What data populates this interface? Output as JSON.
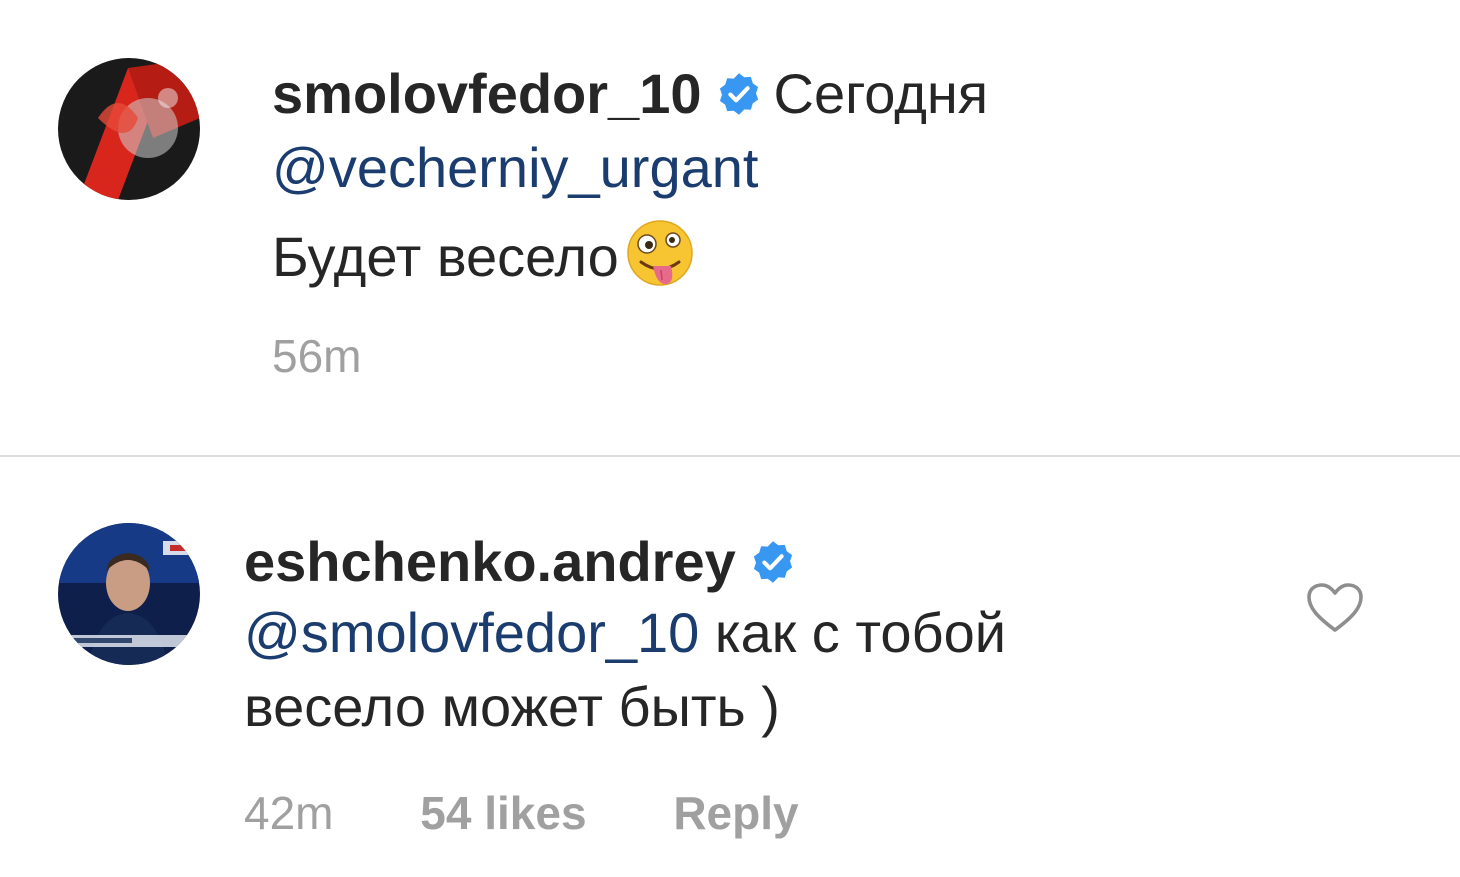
{
  "comments": [
    {
      "username": "smolovfedor_10",
      "verified": true,
      "header_extra": "Сегодня",
      "mention": "@vecherniy_urgant",
      "text": "Будет весело",
      "emoji_name": "zany-face-emoji",
      "time": "56m"
    },
    {
      "username": "eshchenko.andrey",
      "verified": true,
      "mention": "@smolovfedor_10",
      "text_line1": " как с тобой",
      "text_line2": "весело может быть )",
      "time": "42m",
      "likes": "54 likes",
      "reply_label": "Reply",
      "like_icon": "heart-outline-icon"
    }
  ],
  "colors": {
    "verified_badge": "#3897f0",
    "mention": "#1a3c6e",
    "meta_text": "#a0a0a0",
    "divider": "#dcdcdc"
  }
}
